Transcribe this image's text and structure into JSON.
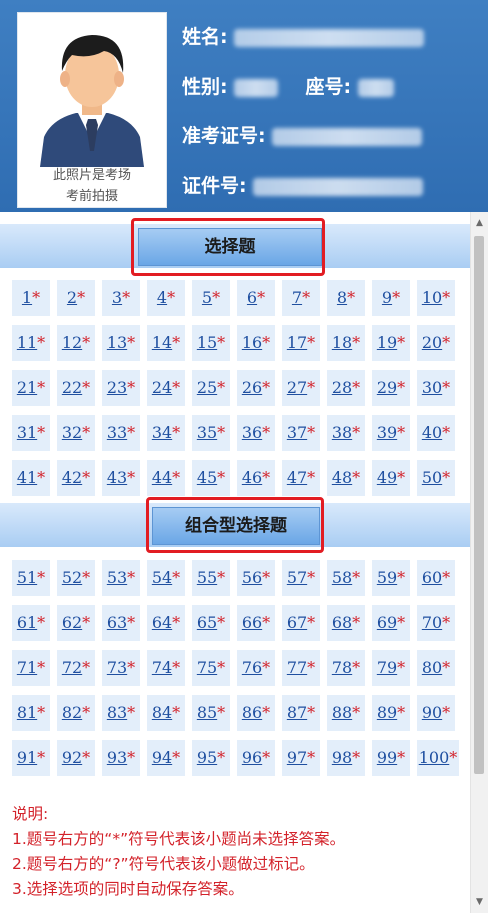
{
  "candidate": {
    "photo_caption_line1": "此照片是考场",
    "photo_caption_line2": "考前拍摄",
    "name_label": "姓名:",
    "gender_label": "性别:",
    "seat_label": "座号:",
    "admission_label": "准考证号:",
    "id_label": "证件号:"
  },
  "sections": [
    {
      "title": "选择题",
      "questions": [
        {
          "num": "1",
          "mark": "*"
        },
        {
          "num": "2",
          "mark": "*"
        },
        {
          "num": "3",
          "mark": "*"
        },
        {
          "num": "4",
          "mark": "*"
        },
        {
          "num": "5",
          "mark": "*"
        },
        {
          "num": "6",
          "mark": "*"
        },
        {
          "num": "7",
          "mark": "*"
        },
        {
          "num": "8",
          "mark": "*"
        },
        {
          "num": "9",
          "mark": "*"
        },
        {
          "num": "10",
          "mark": "*"
        },
        {
          "num": "11",
          "mark": "*"
        },
        {
          "num": "12",
          "mark": "*"
        },
        {
          "num": "13",
          "mark": "*"
        },
        {
          "num": "14",
          "mark": "*"
        },
        {
          "num": "15",
          "mark": "*"
        },
        {
          "num": "16",
          "mark": "*"
        },
        {
          "num": "17",
          "mark": "*"
        },
        {
          "num": "18",
          "mark": "*"
        },
        {
          "num": "19",
          "mark": "*"
        },
        {
          "num": "20",
          "mark": "*"
        },
        {
          "num": "21",
          "mark": "*"
        },
        {
          "num": "22",
          "mark": "*"
        },
        {
          "num": "23",
          "mark": "*"
        },
        {
          "num": "24",
          "mark": "*"
        },
        {
          "num": "25",
          "mark": "*"
        },
        {
          "num": "26",
          "mark": "*"
        },
        {
          "num": "27",
          "mark": "*"
        },
        {
          "num": "28",
          "mark": "*"
        },
        {
          "num": "29",
          "mark": "*"
        },
        {
          "num": "30",
          "mark": "*"
        },
        {
          "num": "31",
          "mark": "*"
        },
        {
          "num": "32",
          "mark": "*"
        },
        {
          "num": "33",
          "mark": "*"
        },
        {
          "num": "34",
          "mark": "*"
        },
        {
          "num": "35",
          "mark": "*"
        },
        {
          "num": "36",
          "mark": "*"
        },
        {
          "num": "37",
          "mark": "*"
        },
        {
          "num": "38",
          "mark": "*"
        },
        {
          "num": "39",
          "mark": "*"
        },
        {
          "num": "40",
          "mark": "*"
        },
        {
          "num": "41",
          "mark": "*"
        },
        {
          "num": "42",
          "mark": "*"
        },
        {
          "num": "43",
          "mark": "*"
        },
        {
          "num": "44",
          "mark": "*"
        },
        {
          "num": "45",
          "mark": "*"
        },
        {
          "num": "46",
          "mark": "*"
        },
        {
          "num": "47",
          "mark": "*"
        },
        {
          "num": "48",
          "mark": "*"
        },
        {
          "num": "49",
          "mark": "*"
        },
        {
          "num": "50",
          "mark": "*"
        }
      ]
    },
    {
      "title": "组合型选择题",
      "questions": [
        {
          "num": "51",
          "mark": "*"
        },
        {
          "num": "52",
          "mark": "*"
        },
        {
          "num": "53",
          "mark": "*"
        },
        {
          "num": "54",
          "mark": "*"
        },
        {
          "num": "55",
          "mark": "*"
        },
        {
          "num": "56",
          "mark": "*"
        },
        {
          "num": "57",
          "mark": "*"
        },
        {
          "num": "58",
          "mark": "*"
        },
        {
          "num": "59",
          "mark": "*"
        },
        {
          "num": "60",
          "mark": "*"
        },
        {
          "num": "61",
          "mark": "*"
        },
        {
          "num": "62",
          "mark": "*"
        },
        {
          "num": "63",
          "mark": "*"
        },
        {
          "num": "64",
          "mark": "*"
        },
        {
          "num": "65",
          "mark": "*"
        },
        {
          "num": "66",
          "mark": "*"
        },
        {
          "num": "67",
          "mark": "*"
        },
        {
          "num": "68",
          "mark": "*"
        },
        {
          "num": "69",
          "mark": "*"
        },
        {
          "num": "70",
          "mark": "*"
        },
        {
          "num": "71",
          "mark": "*"
        },
        {
          "num": "72",
          "mark": "*"
        },
        {
          "num": "73",
          "mark": "*"
        },
        {
          "num": "74",
          "mark": "*"
        },
        {
          "num": "75",
          "mark": "*"
        },
        {
          "num": "76",
          "mark": "*"
        },
        {
          "num": "77",
          "mark": "*"
        },
        {
          "num": "78",
          "mark": "*"
        },
        {
          "num": "79",
          "mark": "*"
        },
        {
          "num": "80",
          "mark": "*"
        },
        {
          "num": "81",
          "mark": "*"
        },
        {
          "num": "82",
          "mark": "*"
        },
        {
          "num": "83",
          "mark": "*"
        },
        {
          "num": "84",
          "mark": "*"
        },
        {
          "num": "85",
          "mark": "*"
        },
        {
          "num": "86",
          "mark": "*"
        },
        {
          "num": "87",
          "mark": "*"
        },
        {
          "num": "88",
          "mark": "*"
        },
        {
          "num": "89",
          "mark": "*"
        },
        {
          "num": "90",
          "mark": "*"
        },
        {
          "num": "91",
          "mark": "*"
        },
        {
          "num": "92",
          "mark": "*"
        },
        {
          "num": "93",
          "mark": "*"
        },
        {
          "num": "94",
          "mark": "*"
        },
        {
          "num": "95",
          "mark": "*"
        },
        {
          "num": "96",
          "mark": "*"
        },
        {
          "num": "97",
          "mark": "*"
        },
        {
          "num": "98",
          "mark": "*"
        },
        {
          "num": "99",
          "mark": "*"
        },
        {
          "num": "100",
          "mark": "*"
        }
      ]
    }
  ],
  "notes": {
    "heading": "说明:",
    "line1": "1.题号右方的“*”符号代表该小题尚未选择答案。",
    "line2": "2.题号右方的“?”符号代表该小题做过标记。",
    "line3": "3.选择选项的同时自动保存答案。"
  },
  "colors": {
    "header_bg": "#3a78bd",
    "question_number": "#1f4fa0",
    "unanswered_mark": "#d3222a",
    "highlight_box": "#e21c22",
    "notes_text": "#d3222a"
  },
  "icons": {
    "photo": "candidate-avatar-icon",
    "scroll_up": "scroll-up-arrow-icon",
    "scroll_down": "scroll-down-arrow-icon"
  }
}
